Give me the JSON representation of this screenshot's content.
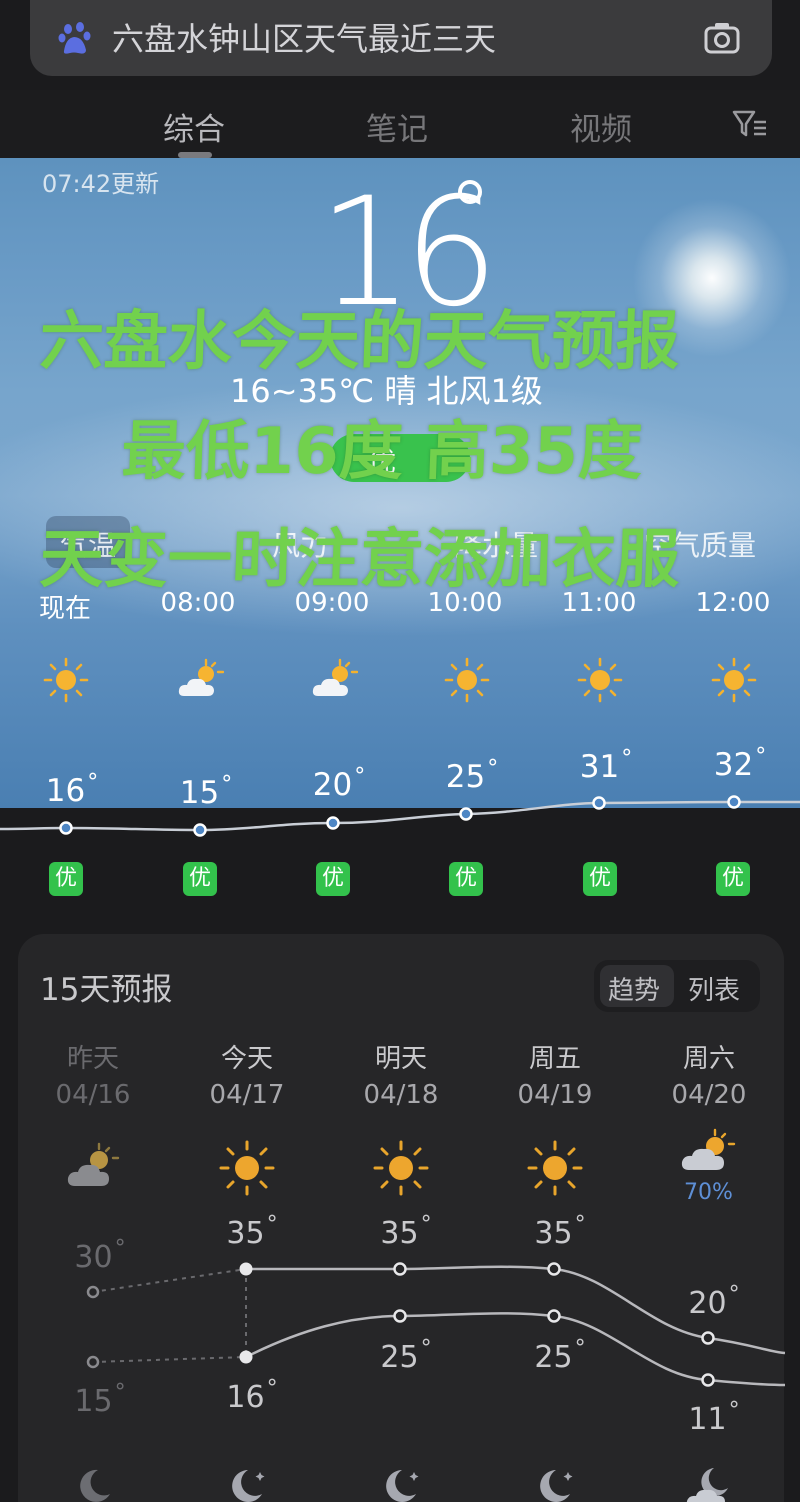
{
  "search": {
    "query": "六盘水钟山区天气最近三天"
  },
  "tabs": [
    {
      "label": "综合"
    },
    {
      "label": "笔记"
    },
    {
      "label": "视频"
    }
  ],
  "hero": {
    "updated": "07:42更新",
    "temperature": "16",
    "summary": "16~35℃ 晴 北风1级",
    "aqi_label": "优",
    "chips": [
      "气温",
      "风力",
      "降水量",
      "空气质量"
    ],
    "overlay_lines": [
      "六盘水今天的天气预报",
      "最低16度 高35度",
      "天变一时注意添加衣服"
    ]
  },
  "hourly": [
    {
      "time": "现在",
      "icon": "sun-icon",
      "temp": "16",
      "aqi": "优"
    },
    {
      "time": "08:00",
      "icon": "partly-cloudy-icon",
      "temp": "15",
      "aqi": "优"
    },
    {
      "time": "09:00",
      "icon": "partly-cloudy-icon",
      "temp": "20",
      "aqi": "优"
    },
    {
      "time": "10:00",
      "icon": "sun-icon",
      "temp": "25",
      "aqi": "优"
    },
    {
      "time": "11:00",
      "icon": "sun-icon",
      "temp": "31",
      "aqi": "优"
    },
    {
      "time": "12:00",
      "icon": "sun-icon",
      "temp": "32",
      "aqi": "优"
    }
  ],
  "forecast": {
    "title": "15天预报",
    "toggle": [
      "趋势",
      "列表"
    ],
    "days": [
      {
        "name": "昨天",
        "date": "04/16",
        "icon": "partly-cloudy-icon",
        "high": "30",
        "low": "15",
        "night_icon": "moon-icon"
      },
      {
        "name": "今天",
        "date": "04/17",
        "icon": "sun-icon",
        "high": "35",
        "low": "16",
        "night_icon": "moon-icon"
      },
      {
        "name": "明天",
        "date": "04/18",
        "icon": "sun-icon",
        "high": "35",
        "low": "25",
        "night_icon": "moon-icon"
      },
      {
        "name": "周五",
        "date": "04/19",
        "icon": "sun-icon",
        "high": "35",
        "low": "25",
        "night_icon": "moon-icon"
      },
      {
        "name": "周六",
        "date": "04/20",
        "icon": "rain-shower-icon",
        "high": "20",
        "low": "11",
        "precip": "70%",
        "night_icon": "moon-cloud-icon"
      }
    ]
  },
  "colors": {
    "aqi_green": "#39c24d",
    "overlay_green": "#72d14d",
    "card_bg": "#262628"
  }
}
